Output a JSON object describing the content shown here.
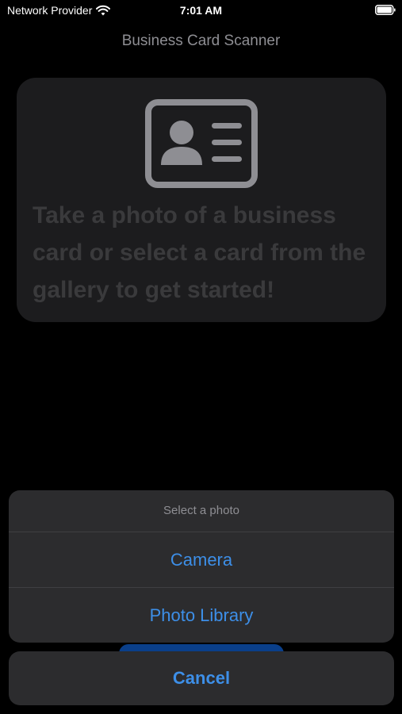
{
  "status_bar": {
    "carrier": "Network Provider",
    "time": "7:01 AM",
    "icons": [
      "wifi-icon",
      "battery-icon"
    ]
  },
  "nav": {
    "title": "Business Card Scanner"
  },
  "empty_state": {
    "icon": "id-card-icon",
    "message": "Take a photo of a business card or select a card from the gallery to get started!"
  },
  "action_sheet": {
    "title": "Select a photo",
    "options": [
      {
        "label": "Camera"
      },
      {
        "label": "Photo Library"
      }
    ],
    "cancel_label": "Cancel"
  },
  "colors": {
    "background": "#000000",
    "sheet_background": "#2c2c2e",
    "accent": "#3d8fe8",
    "placeholder_text": "#3a3a3c",
    "card_icon": "#8e8e93"
  }
}
